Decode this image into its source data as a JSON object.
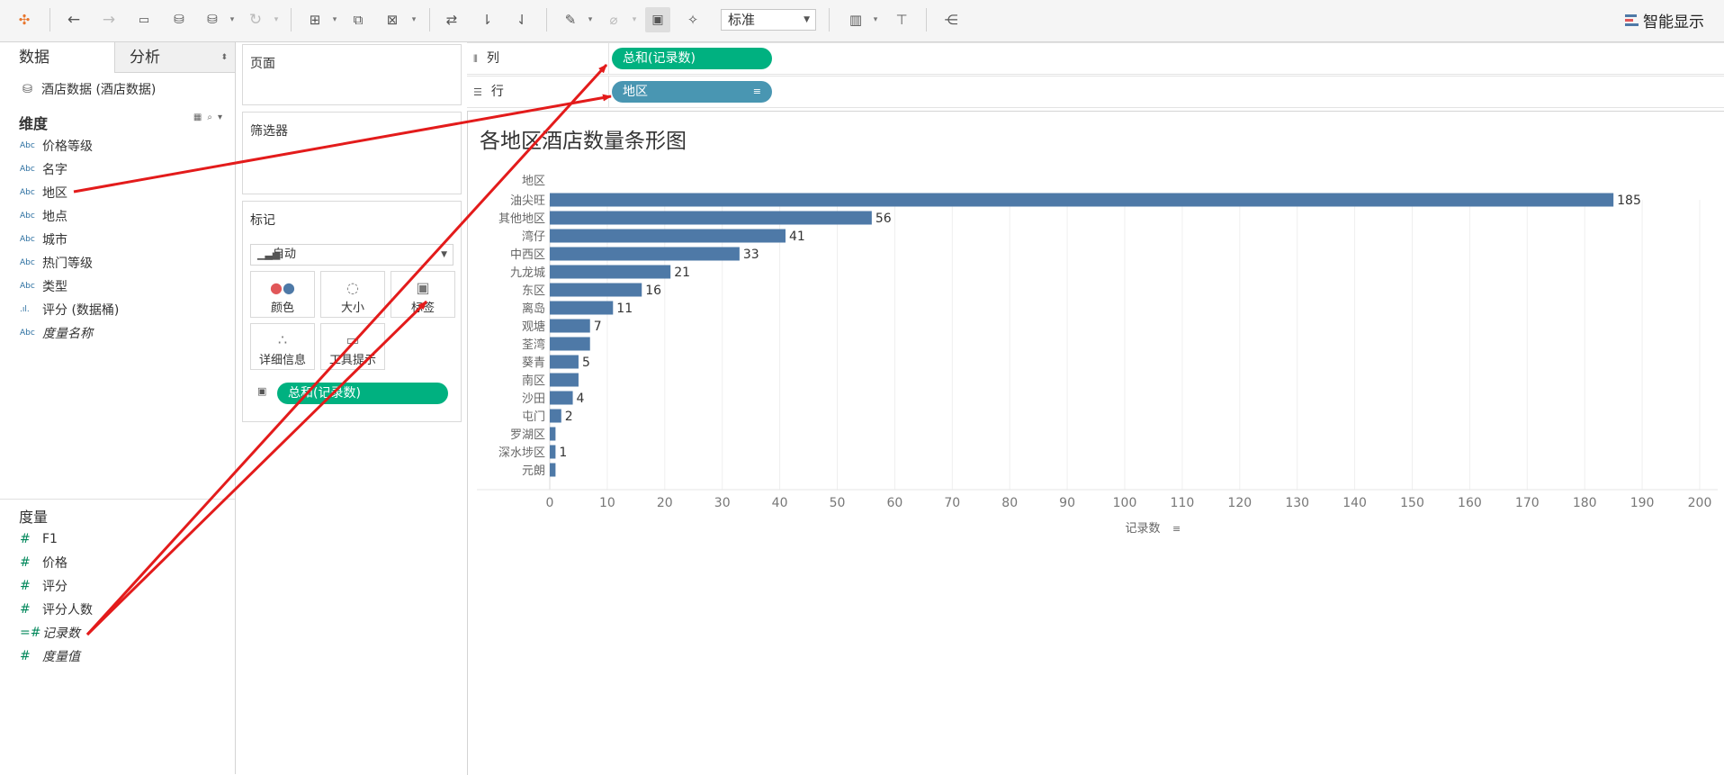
{
  "toolbar": {
    "fit_select": "标准",
    "show_me": "智能显示",
    "show_me_colors": [
      "#4e79a7",
      "#e15759",
      "#4e79a7"
    ],
    "icons": [
      "tableau-logo-icon",
      "undo-icon",
      "redo-icon",
      "save-icon",
      "new-datasource-icon",
      "datasource-options-icon",
      "refresh-icon",
      "new-worksheet-icon",
      "duplicate-icon",
      "clear-icon",
      "swap-icon",
      "sort-ascending-icon",
      "sort-descending-icon",
      "highlight-icon",
      "group-icon",
      "labels-icon",
      "pin-icon",
      "fit-width-icon",
      "presentation-icon",
      "share-icon"
    ]
  },
  "data_pane": {
    "tab_data": "数据",
    "tab_analysis": "分析",
    "datasource": "酒店数据 (酒店数据)",
    "dimensions_title": "维度",
    "dimensions": [
      {
        "type": "Abc",
        "label": "价格等级",
        "italic": false
      },
      {
        "type": "Abc",
        "label": "名字",
        "italic": false
      },
      {
        "type": "Abc",
        "label": "地区",
        "italic": false
      },
      {
        "type": "Abc",
        "label": "地点",
        "italic": false
      },
      {
        "type": "Abc",
        "label": "城市",
        "italic": false
      },
      {
        "type": "Abc",
        "label": "热门等级",
        "italic": false
      },
      {
        "type": "Abc",
        "label": "类型",
        "italic": false
      },
      {
        "type": ".ıl.",
        "label": "评分 (数据桶)",
        "italic": false
      },
      {
        "type": "Abc",
        "label": "度量名称",
        "italic": true
      }
    ],
    "measures_title": "度量",
    "measures": [
      {
        "type": "#",
        "label": "F1",
        "italic": false
      },
      {
        "type": "#",
        "label": "价格",
        "italic": false
      },
      {
        "type": "#",
        "label": "评分",
        "italic": false
      },
      {
        "type": "#",
        "label": "评分人数",
        "italic": false
      },
      {
        "type": "=#",
        "label": "记录数",
        "italic": true
      },
      {
        "type": "#",
        "label": "度量值",
        "italic": true
      }
    ]
  },
  "cards": {
    "pages": "页面",
    "filters": "筛选器",
    "marks": "标记",
    "marks_type": "自动",
    "buttons": [
      "颜色",
      "大小",
      "标签",
      "详细信息",
      "工具提示"
    ],
    "label_pill": "总和(记录数)"
  },
  "shelves": {
    "columns_label": "列",
    "columns_pill": "总和(记录数)",
    "rows_label": "行",
    "rows_pill": "地区"
  },
  "colors": {
    "bar": "#4e79a7",
    "pill_green": "#00b180",
    "pill_blue": "#4996b2",
    "arrow": "#e31b1b"
  },
  "chart_data": {
    "type": "bar",
    "orientation": "horizontal",
    "title": "各地区酒店数量条形图",
    "row_header": "地区",
    "xlabel": "记录数",
    "categories": [
      "油尖旺",
      "其他地区",
      "湾仔",
      "中西区",
      "九龙城",
      "东区",
      "离岛",
      "观塘",
      "荃湾",
      "葵青",
      "南区",
      "沙田",
      "屯门",
      "罗湖区",
      "深水埗区",
      "元朗"
    ],
    "values": [
      185,
      56,
      41,
      33,
      21,
      16,
      11,
      7,
      7,
      5,
      5,
      4,
      2,
      1,
      1,
      1
    ],
    "data_labels": [
      "185",
      "56",
      "41",
      "33",
      "21",
      "16",
      "11",
      "7",
      "",
      "5",
      "",
      "4",
      "2",
      "",
      "1",
      ""
    ],
    "xlim": [
      0,
      200
    ],
    "xticks": [
      0,
      10,
      20,
      30,
      40,
      50,
      60,
      70,
      80,
      90,
      100,
      110,
      120,
      130,
      140,
      150,
      160,
      170,
      180,
      190,
      200
    ],
    "grid": true
  }
}
